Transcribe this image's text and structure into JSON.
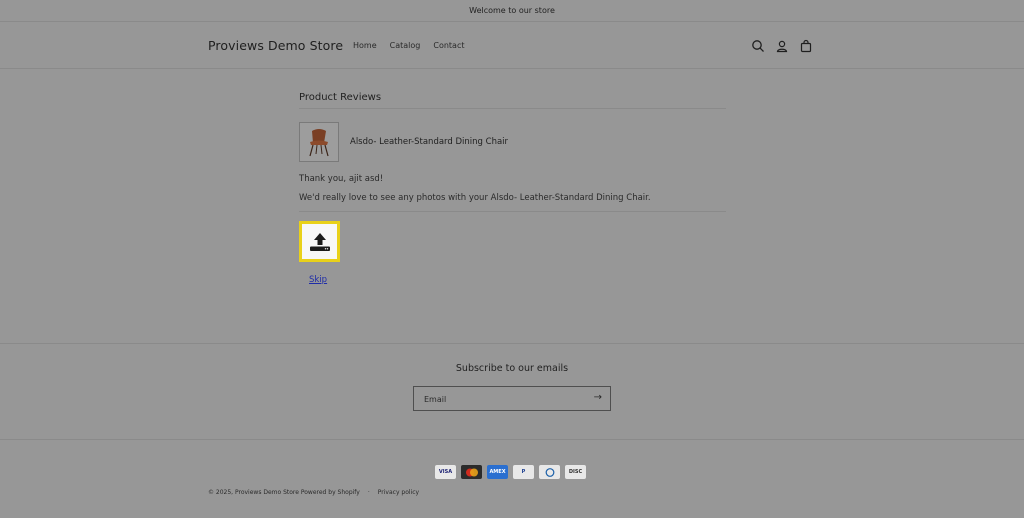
{
  "announcement": "Welcome to our store",
  "header": {
    "brand": "Proviews Demo Store",
    "nav": [
      "Home",
      "Catalog",
      "Contact"
    ],
    "icons": [
      "search-icon",
      "account-icon",
      "cart-icon"
    ]
  },
  "review": {
    "title": "Product Reviews",
    "product_name": "Alsdo- Leather-Standard Dining Chair",
    "thanks": "Thank you, ajit asd!",
    "message": "We'd really love to see any photos with your Alsdo- Leather-Standard Dining Chair.",
    "upload_icon": "upload-icon",
    "skip_label": "Skip"
  },
  "subscribe": {
    "title": "Subscribe to our emails",
    "placeholder": "Email",
    "submit_icon": "arrow-right-icon"
  },
  "payments": [
    "Visa",
    "Mastercard",
    "American Express",
    "PayPal",
    "Diners Club",
    "Discover"
  ],
  "footer": {
    "copyright": "© 2025, Proviews Demo Store Powered by Shopify",
    "separator": "·",
    "privacy": "Privacy policy"
  },
  "colors": {
    "background": "#979797",
    "upload_highlight": "#e9d11a",
    "link": "#1e2ca8"
  }
}
